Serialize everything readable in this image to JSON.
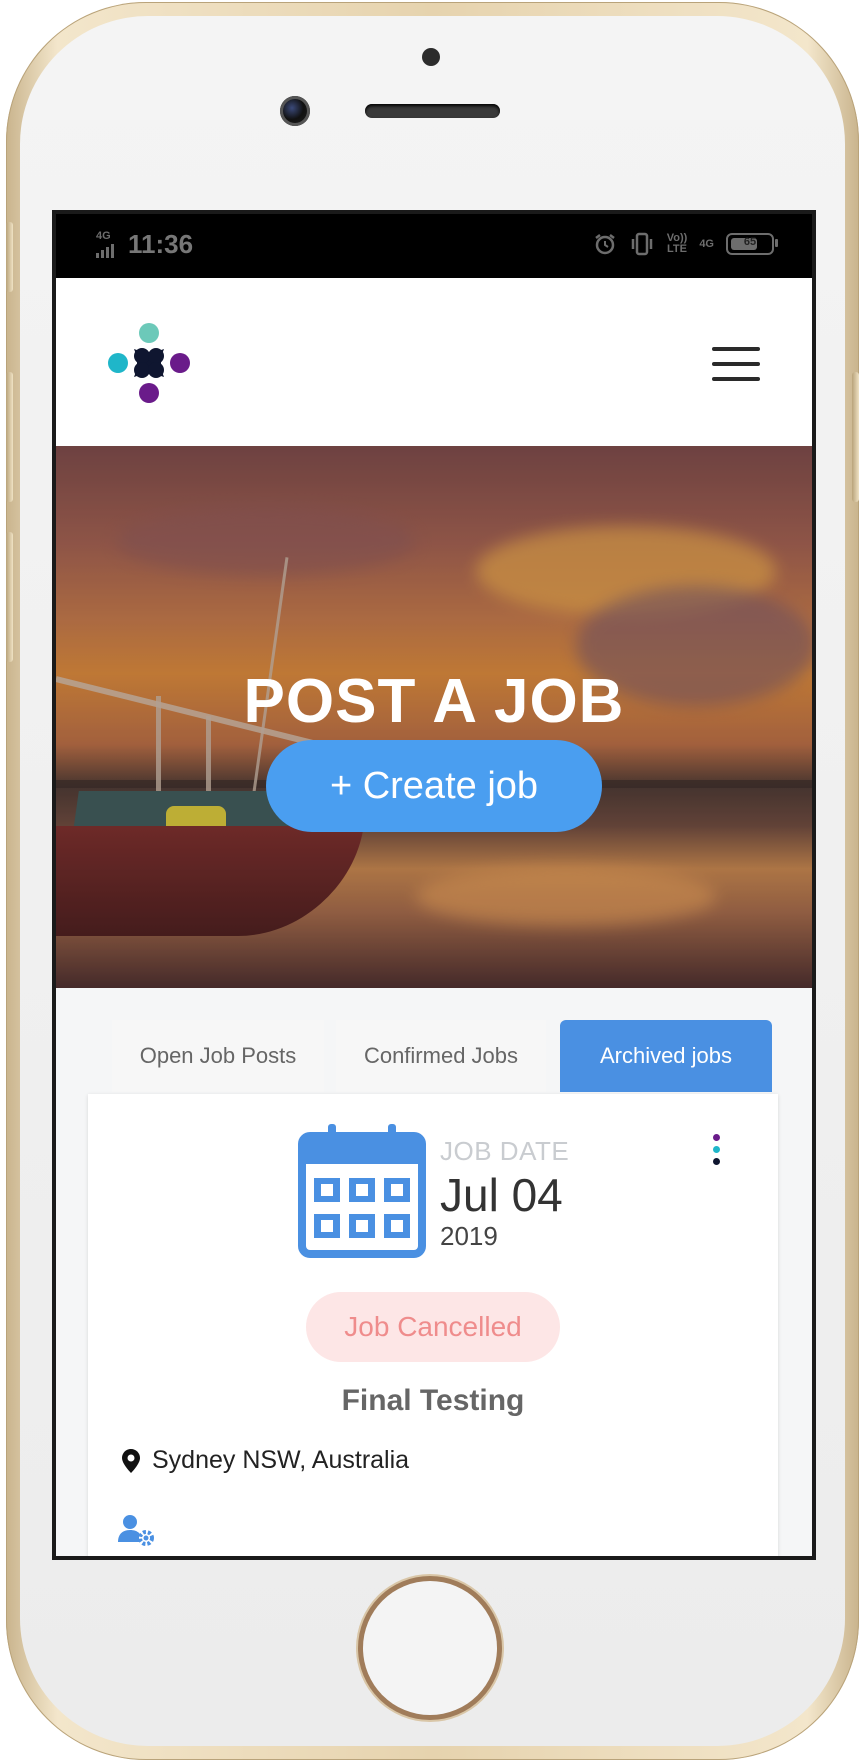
{
  "status_bar": {
    "network": "4G",
    "time": "11:36",
    "volte_label_top": "Vo))",
    "volte_label_bottom": "LTE",
    "net2_label": "4G",
    "battery_level": "65",
    "icons": [
      "signal-icon",
      "alarm-icon",
      "vibrate-icon",
      "volte-icon",
      "battery-icon"
    ]
  },
  "header": {
    "logo_icon": "app-logo-icon",
    "menu_icon": "hamburger-menu-icon"
  },
  "hero": {
    "title": "POST A JOB",
    "create_button_label": "+ Create job"
  },
  "tabs": [
    {
      "label": "Open Job Posts",
      "active": false
    },
    {
      "label": "Confirmed Jobs",
      "active": false
    },
    {
      "label": "Archived jobs",
      "active": true
    }
  ],
  "job": {
    "date_caption": "JOB DATE",
    "date": "Jul 04",
    "year": "2019",
    "status": "Job Cancelled",
    "title": "Final Testing",
    "location": "Sydney NSW, Australia"
  },
  "colors": {
    "accent_blue": "#4a90e2",
    "button_blue": "#4a9ef0",
    "badge_bg": "#fde6e6",
    "badge_text": "#ef8c8c",
    "logo_teal": "#6cc9b9",
    "logo_cyan": "#1fb6c9",
    "logo_purple": "#6a1b8a",
    "logo_navy": "#0f1630"
  }
}
